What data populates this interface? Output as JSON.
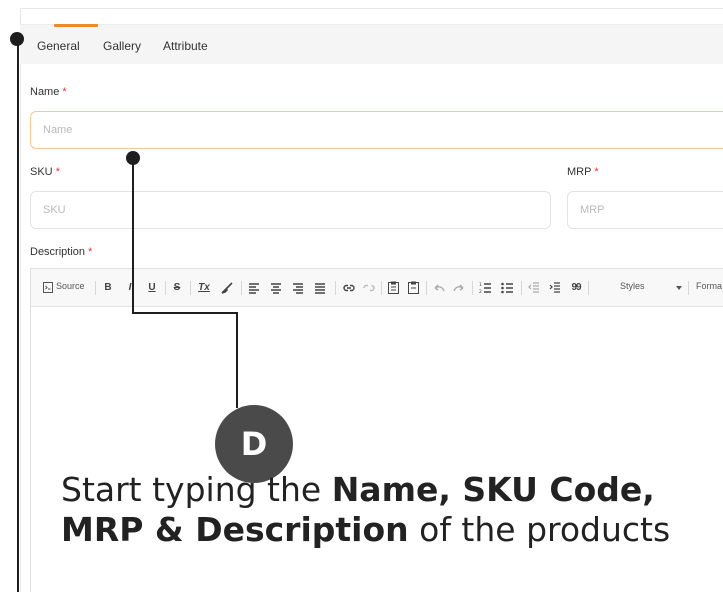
{
  "tabs": [
    {
      "label": "General",
      "active": true
    },
    {
      "label": "Gallery",
      "active": false
    },
    {
      "label": "Attribute",
      "active": false
    }
  ],
  "form": {
    "required_mark": "*",
    "name": {
      "label": "Name",
      "placeholder": "Name",
      "value": ""
    },
    "sku": {
      "label": "SKU",
      "placeholder": "SKU",
      "value": ""
    },
    "mrp": {
      "label": "MRP",
      "placeholder": "MRP",
      "value": ""
    },
    "description": {
      "label": "Description"
    }
  },
  "editor_toolbar": {
    "source_label": "Source",
    "bold": "B",
    "italic": "I",
    "underline": "U",
    "strike": "S",
    "remove_format": "Tx",
    "blockquote": "99",
    "styles_label": "Styles",
    "format_label": "Forma"
  },
  "callout": {
    "badge": "D",
    "text_prefix": "Start typing the ",
    "text_bold_1": "Name, SKU Code, MRP & Description",
    "text_suffix": " of the products"
  },
  "colors": {
    "accent": "#f08a24",
    "required": "#e53935",
    "badge": "#4a4a4a",
    "callout_line": "#1e1e1e"
  }
}
